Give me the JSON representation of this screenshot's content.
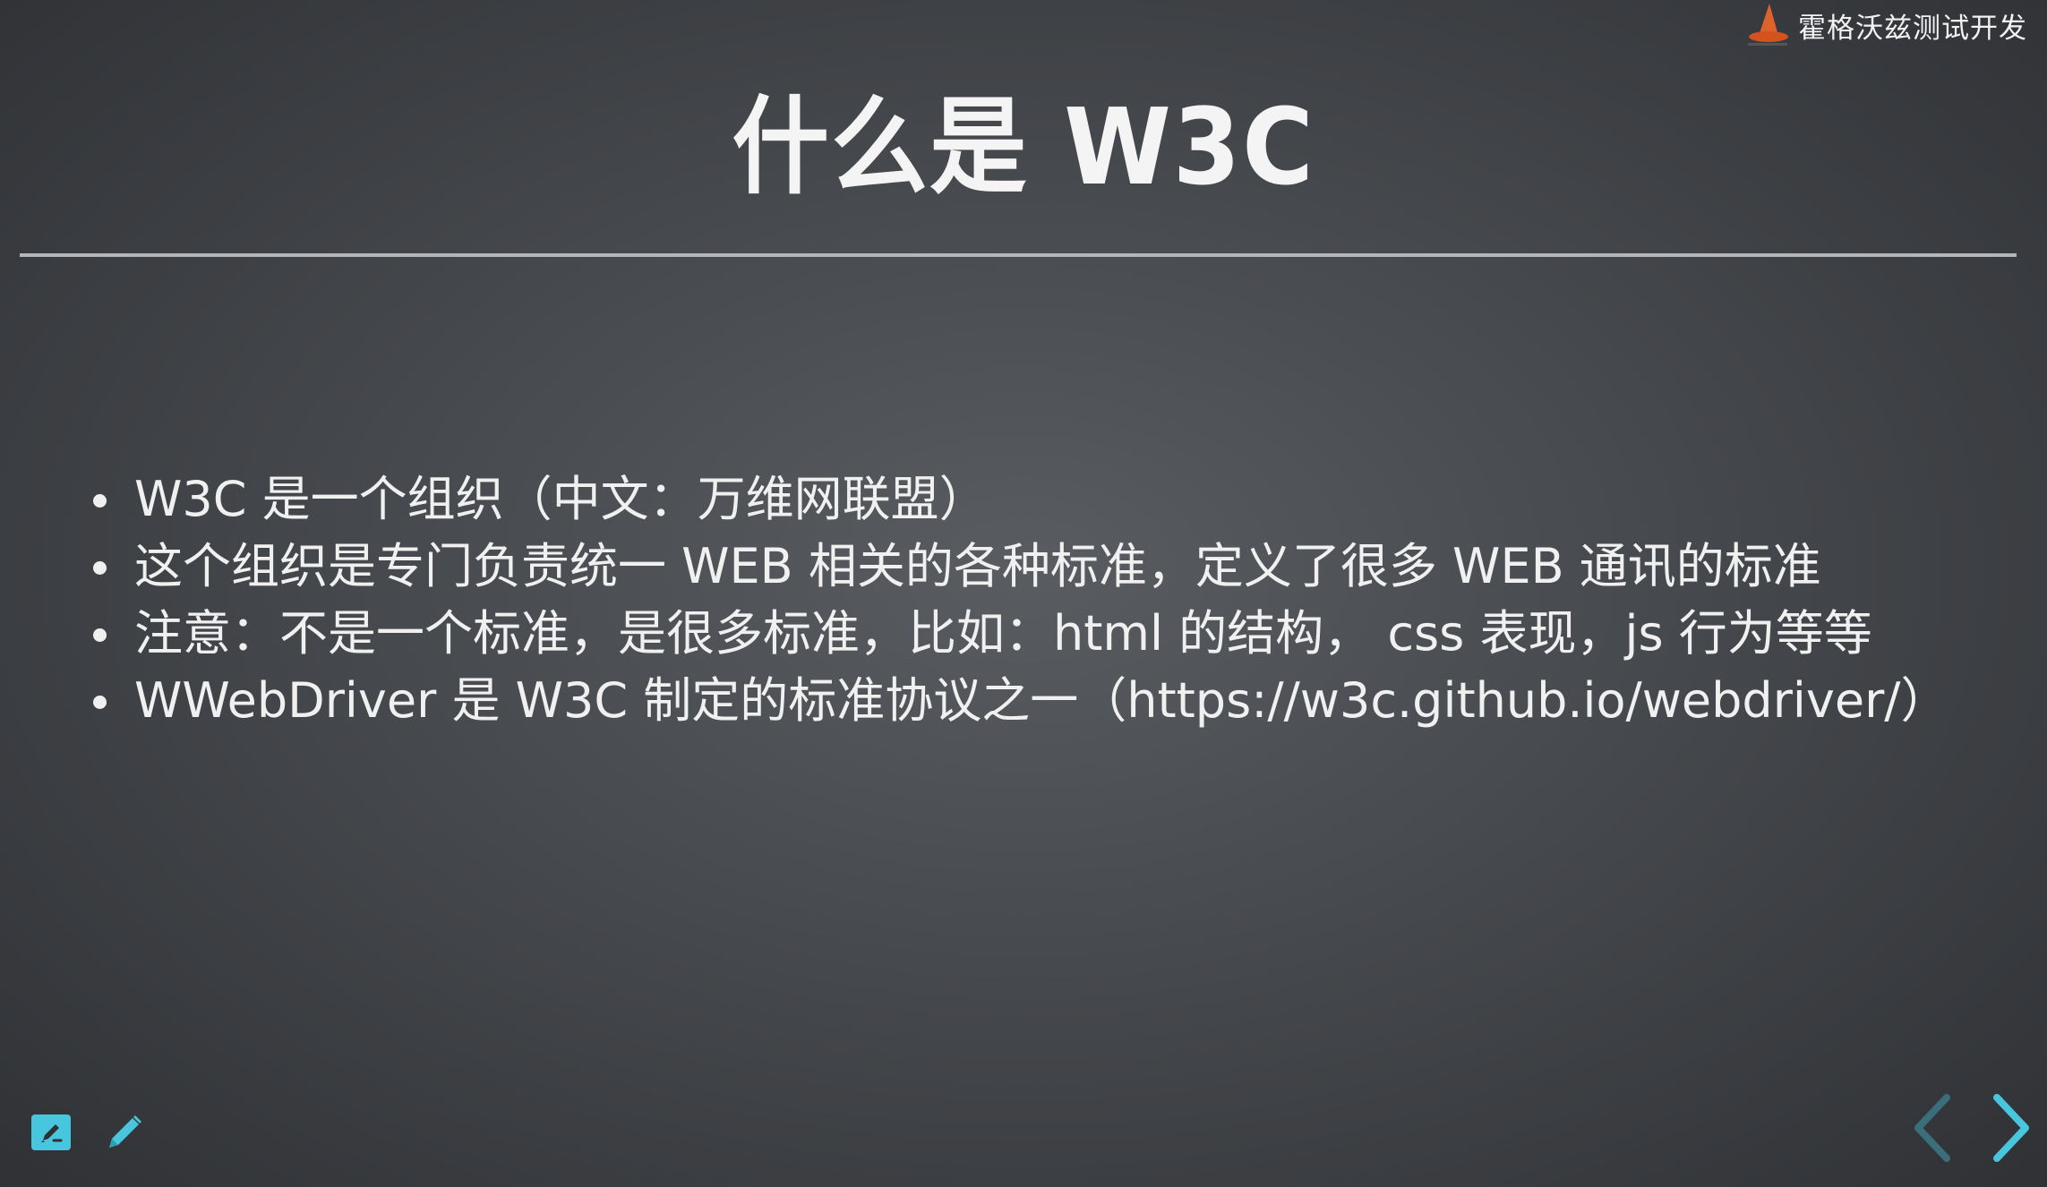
{
  "brand": {
    "name": "霍格沃兹测试开发",
    "logo_icon": "wizard-hat-icon"
  },
  "slide": {
    "title": "什么是 W3C",
    "bullets": [
      "W3C 是一个组织（中文：万维网联盟）",
      "这个组织是专门负责统一 WEB 相关的各种标准，定义了很多 WEB 通讯的标准",
      "注意：不是一个标准，是很多标准，比如：html 的结构， css 表现，js 行为等等",
      "WWebDriver 是 W3C 制定的标准协议之一（https://w3c.github.io/webdriver/）"
    ]
  },
  "toolbar": {
    "whiteboard_icon": "whiteboard-icon",
    "pen_icon": "pencil-icon"
  },
  "navigation": {
    "prev_icon": "chevron-left-icon",
    "next_icon": "chevron-right-icon"
  },
  "colors": {
    "accent": "#48c6dd",
    "accent_dim": "#3a6e7a",
    "text": "#f0f0f0",
    "rule": "#b4b6b9"
  }
}
